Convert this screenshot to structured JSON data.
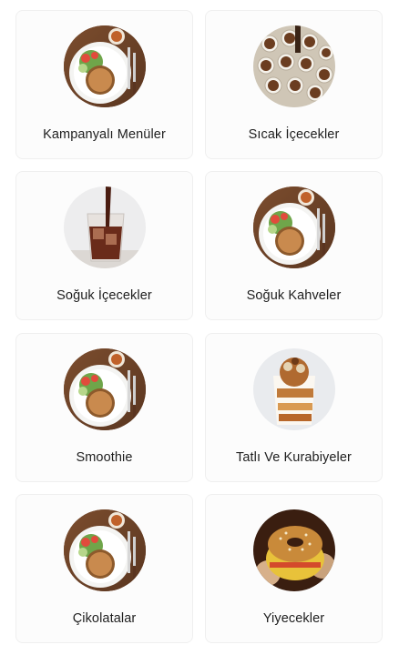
{
  "categories": [
    {
      "label": "Kampanyalı Menüler",
      "image": "plate-with-burger"
    },
    {
      "label": "Sıcak İçecekler",
      "image": "coffee-cups"
    },
    {
      "label": "Soğuk İçecekler",
      "image": "iced-cola-glass"
    },
    {
      "label": "Soğuk Kahveler",
      "image": "plate-with-burger"
    },
    {
      "label": "Smoothie",
      "image": "plate-with-burger"
    },
    {
      "label": "Tatlı Ve Kurabiyeler",
      "image": "dessert-jar"
    },
    {
      "label": "Çikolatalar",
      "image": "plate-with-burger"
    },
    {
      "label": "Yiyecekler",
      "image": "bagel-sandwich"
    }
  ]
}
